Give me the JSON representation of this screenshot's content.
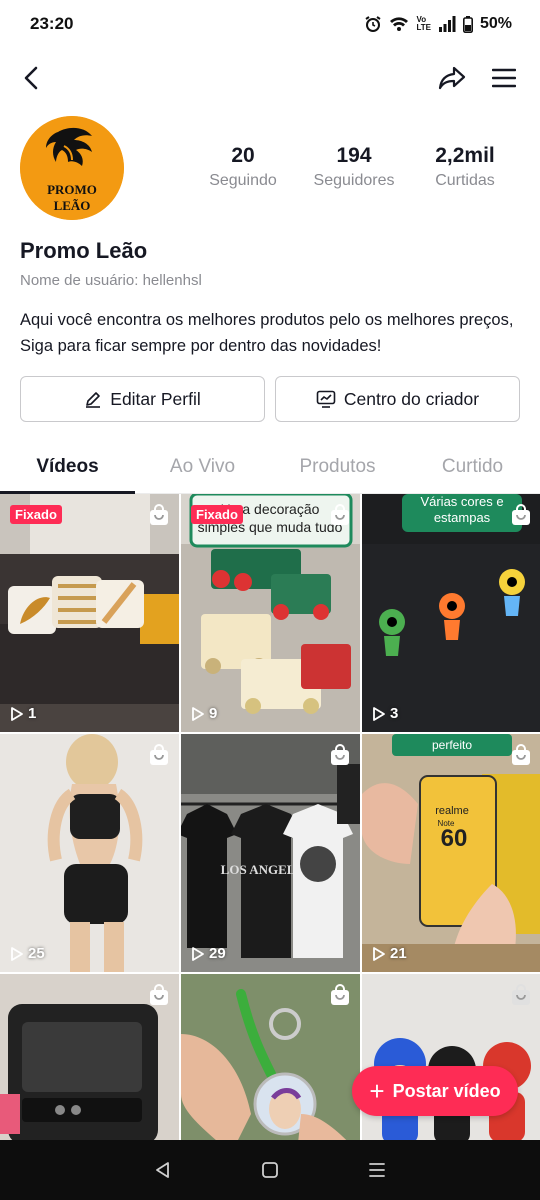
{
  "status": {
    "time": "23:20",
    "battery": "50%",
    "vol_top": "Vo",
    "vol_bottom": "LTE"
  },
  "profile": {
    "avatar_text_line1": "PROMO",
    "avatar_text_line2": "LEÃO",
    "name": "Promo Leão",
    "username": "Nome de usuário: hellenhsl",
    "bio": "Aqui você encontra os melhores produtos pelo os melhores preços, Siga para ficar sempre por dentro das novidades!"
  },
  "stats": [
    {
      "value": "20",
      "label": "Seguindo"
    },
    {
      "value": "194",
      "label": "Seguidores"
    },
    {
      "value": "2,2mil",
      "label": "Curtidas"
    }
  ],
  "actions": {
    "edit_label": "Editar Perfil",
    "creator_label": "Centro do criador"
  },
  "tabs": [
    {
      "label": "Vídeos",
      "active": true
    },
    {
      "label": "Ao Vivo",
      "active": false
    },
    {
      "label": "Produtos",
      "active": false
    },
    {
      "label": "Curtido",
      "active": false
    }
  ],
  "videos": [
    {
      "pinned": "Fixado",
      "views": "1",
      "overlay": ""
    },
    {
      "pinned": "Fixado",
      "views": "9",
      "overlay": "Uma decoração simples que muda tudo"
    },
    {
      "pinned": "",
      "views": "3",
      "overlay": "Várias cores e estampas"
    },
    {
      "pinned": "",
      "views": "25",
      "overlay": ""
    },
    {
      "pinned": "",
      "views": "29",
      "overlay": "LOS ANGELES"
    },
    {
      "pinned": "",
      "views": "21",
      "overlay": "perfeito"
    },
    {
      "pinned": "",
      "views": "",
      "overlay": ""
    },
    {
      "pinned": "",
      "views": "",
      "overlay": ""
    },
    {
      "pinned": "",
      "views": "",
      "overlay": ""
    }
  ],
  "phone_text": {
    "brand": "realme",
    "model": "Note",
    "number": "60"
  },
  "post_button": {
    "label": "Postar vídeo",
    "icon": "plus-icon"
  },
  "colors": {
    "accent": "#fe2c55",
    "avatar_bg": "#f39a12",
    "text": "#161823",
    "muted": "#8a8b91"
  }
}
